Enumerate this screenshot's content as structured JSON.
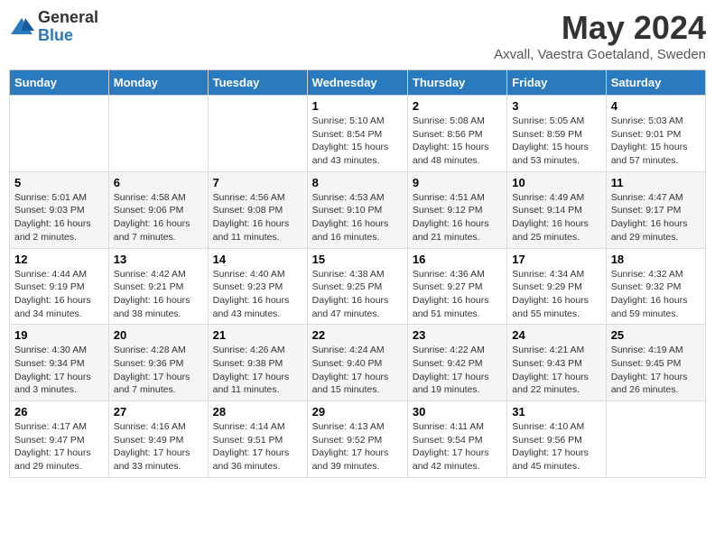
{
  "logo": {
    "general": "General",
    "blue": "Blue"
  },
  "title": {
    "month": "May 2024",
    "location": "Axvall, Vaestra Goetaland, Sweden"
  },
  "weekdays": [
    "Sunday",
    "Monday",
    "Tuesday",
    "Wednesday",
    "Thursday",
    "Friday",
    "Saturday"
  ],
  "weeks": [
    [
      {
        "day": "",
        "info": ""
      },
      {
        "day": "",
        "info": ""
      },
      {
        "day": "",
        "info": ""
      },
      {
        "day": "1",
        "info": "Sunrise: 5:10 AM\nSunset: 8:54 PM\nDaylight: 15 hours and 43 minutes."
      },
      {
        "day": "2",
        "info": "Sunrise: 5:08 AM\nSunset: 8:56 PM\nDaylight: 15 hours and 48 minutes."
      },
      {
        "day": "3",
        "info": "Sunrise: 5:05 AM\nSunset: 8:59 PM\nDaylight: 15 hours and 53 minutes."
      },
      {
        "day": "4",
        "info": "Sunrise: 5:03 AM\nSunset: 9:01 PM\nDaylight: 15 hours and 57 minutes."
      }
    ],
    [
      {
        "day": "5",
        "info": "Sunrise: 5:01 AM\nSunset: 9:03 PM\nDaylight: 16 hours and 2 minutes."
      },
      {
        "day": "6",
        "info": "Sunrise: 4:58 AM\nSunset: 9:06 PM\nDaylight: 16 hours and 7 minutes."
      },
      {
        "day": "7",
        "info": "Sunrise: 4:56 AM\nSunset: 9:08 PM\nDaylight: 16 hours and 11 minutes."
      },
      {
        "day": "8",
        "info": "Sunrise: 4:53 AM\nSunset: 9:10 PM\nDaylight: 16 hours and 16 minutes."
      },
      {
        "day": "9",
        "info": "Sunrise: 4:51 AM\nSunset: 9:12 PM\nDaylight: 16 hours and 21 minutes."
      },
      {
        "day": "10",
        "info": "Sunrise: 4:49 AM\nSunset: 9:14 PM\nDaylight: 16 hours and 25 minutes."
      },
      {
        "day": "11",
        "info": "Sunrise: 4:47 AM\nSunset: 9:17 PM\nDaylight: 16 hours and 29 minutes."
      }
    ],
    [
      {
        "day": "12",
        "info": "Sunrise: 4:44 AM\nSunset: 9:19 PM\nDaylight: 16 hours and 34 minutes."
      },
      {
        "day": "13",
        "info": "Sunrise: 4:42 AM\nSunset: 9:21 PM\nDaylight: 16 hours and 38 minutes."
      },
      {
        "day": "14",
        "info": "Sunrise: 4:40 AM\nSunset: 9:23 PM\nDaylight: 16 hours and 43 minutes."
      },
      {
        "day": "15",
        "info": "Sunrise: 4:38 AM\nSunset: 9:25 PM\nDaylight: 16 hours and 47 minutes."
      },
      {
        "day": "16",
        "info": "Sunrise: 4:36 AM\nSunset: 9:27 PM\nDaylight: 16 hours and 51 minutes."
      },
      {
        "day": "17",
        "info": "Sunrise: 4:34 AM\nSunset: 9:29 PM\nDaylight: 16 hours and 55 minutes."
      },
      {
        "day": "18",
        "info": "Sunrise: 4:32 AM\nSunset: 9:32 PM\nDaylight: 16 hours and 59 minutes."
      }
    ],
    [
      {
        "day": "19",
        "info": "Sunrise: 4:30 AM\nSunset: 9:34 PM\nDaylight: 17 hours and 3 minutes."
      },
      {
        "day": "20",
        "info": "Sunrise: 4:28 AM\nSunset: 9:36 PM\nDaylight: 17 hours and 7 minutes."
      },
      {
        "day": "21",
        "info": "Sunrise: 4:26 AM\nSunset: 9:38 PM\nDaylight: 17 hours and 11 minutes."
      },
      {
        "day": "22",
        "info": "Sunrise: 4:24 AM\nSunset: 9:40 PM\nDaylight: 17 hours and 15 minutes."
      },
      {
        "day": "23",
        "info": "Sunrise: 4:22 AM\nSunset: 9:42 PM\nDaylight: 17 hours and 19 minutes."
      },
      {
        "day": "24",
        "info": "Sunrise: 4:21 AM\nSunset: 9:43 PM\nDaylight: 17 hours and 22 minutes."
      },
      {
        "day": "25",
        "info": "Sunrise: 4:19 AM\nSunset: 9:45 PM\nDaylight: 17 hours and 26 minutes."
      }
    ],
    [
      {
        "day": "26",
        "info": "Sunrise: 4:17 AM\nSunset: 9:47 PM\nDaylight: 17 hours and 29 minutes."
      },
      {
        "day": "27",
        "info": "Sunrise: 4:16 AM\nSunset: 9:49 PM\nDaylight: 17 hours and 33 minutes."
      },
      {
        "day": "28",
        "info": "Sunrise: 4:14 AM\nSunset: 9:51 PM\nDaylight: 17 hours and 36 minutes."
      },
      {
        "day": "29",
        "info": "Sunrise: 4:13 AM\nSunset: 9:52 PM\nDaylight: 17 hours and 39 minutes."
      },
      {
        "day": "30",
        "info": "Sunrise: 4:11 AM\nSunset: 9:54 PM\nDaylight: 17 hours and 42 minutes."
      },
      {
        "day": "31",
        "info": "Sunrise: 4:10 AM\nSunset: 9:56 PM\nDaylight: 17 hours and 45 minutes."
      },
      {
        "day": "",
        "info": ""
      }
    ]
  ]
}
